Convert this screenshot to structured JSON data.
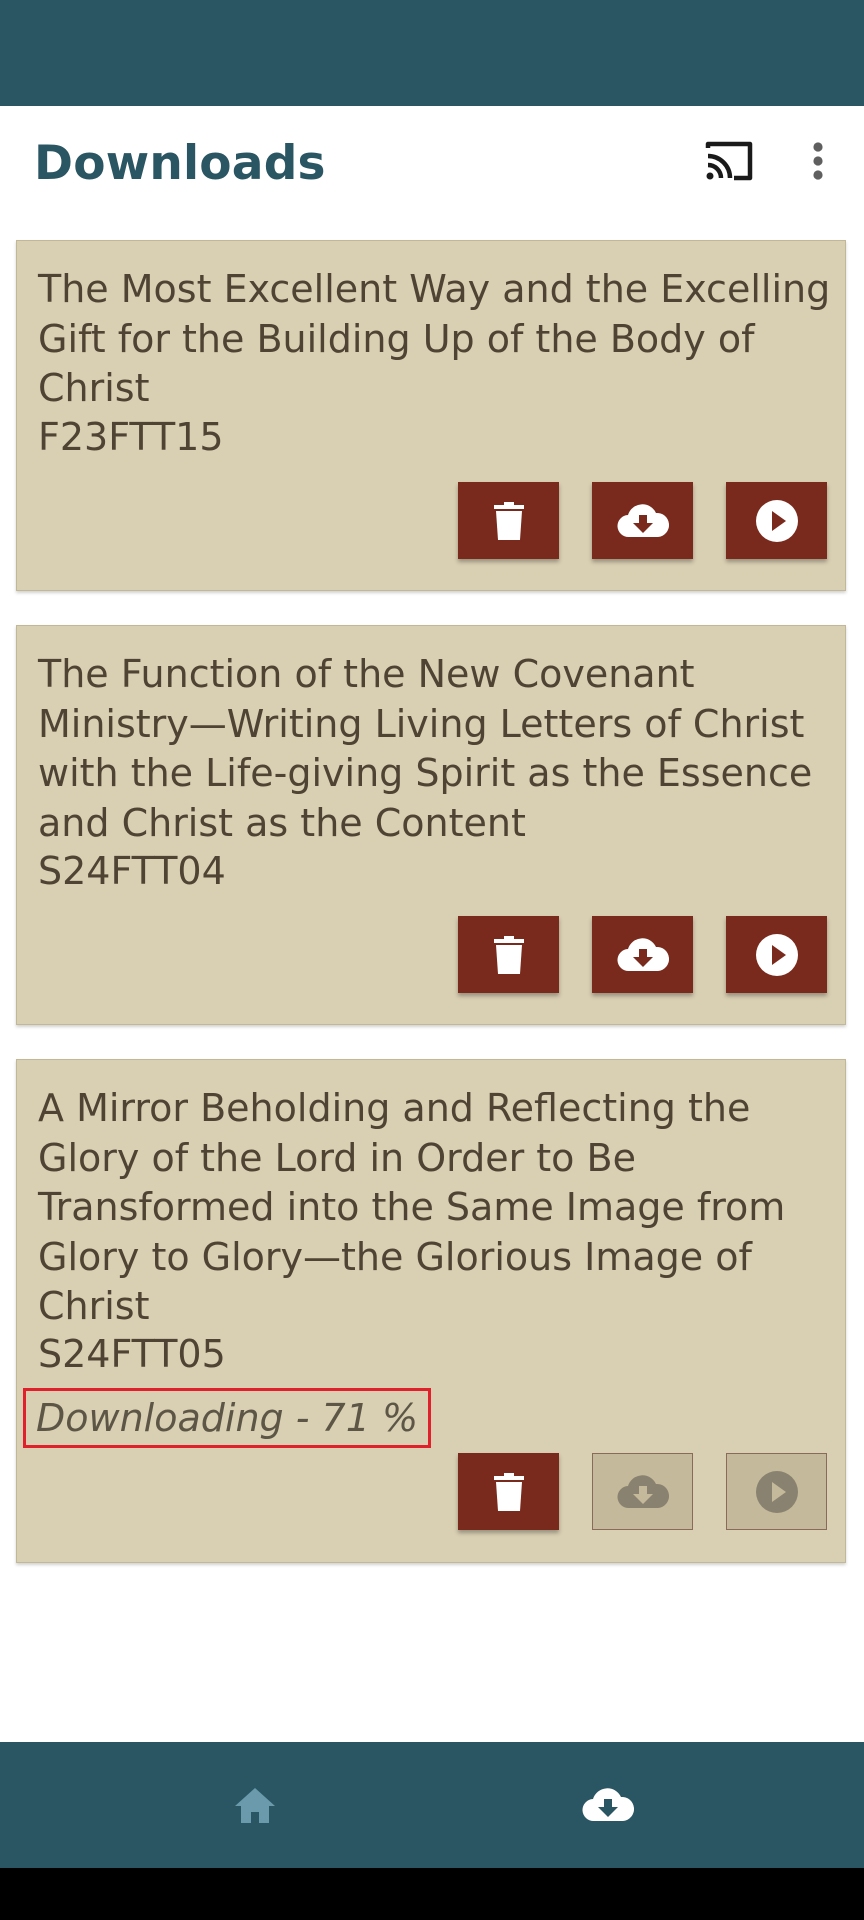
{
  "header": {
    "title": "Downloads",
    "cast_icon": "cast-icon",
    "menu_icon": "more-vert-icon"
  },
  "downloads": [
    {
      "title": "The Most Excellent Way and the Excelling Gift for the Building Up of the Body of Christ",
      "code": "F23FTT15",
      "status": "",
      "download_enabled": true,
      "play_enabled": true
    },
    {
      "title": "The Function of the New Covenant Ministry—Writing Living Letters of Christ with the Life-giving Spirit as the Essence and Christ as the Content",
      "code": "S24FTT04",
      "status": "",
      "download_enabled": true,
      "play_enabled": true
    },
    {
      "title": "A Mirror Beholding and Reflecting the Glory of the Lord in Order to Be Transformed into the Same Image from Glory to Glory—the Glorious Image of Christ",
      "code": "S24FTT05",
      "status": "Downloading - 71 %",
      "progress_percent": 71,
      "download_enabled": false,
      "play_enabled": false
    }
  ],
  "bottom_nav": {
    "items": [
      {
        "icon": "home-icon",
        "selected": false
      },
      {
        "icon": "cloud-download-icon",
        "selected": true
      }
    ]
  },
  "colors": {
    "primary": "#2a5562",
    "card_background": "#d9cfb3",
    "action_button": "#7a2a1c",
    "text": "#4f4433",
    "highlight": "#e0202a"
  }
}
